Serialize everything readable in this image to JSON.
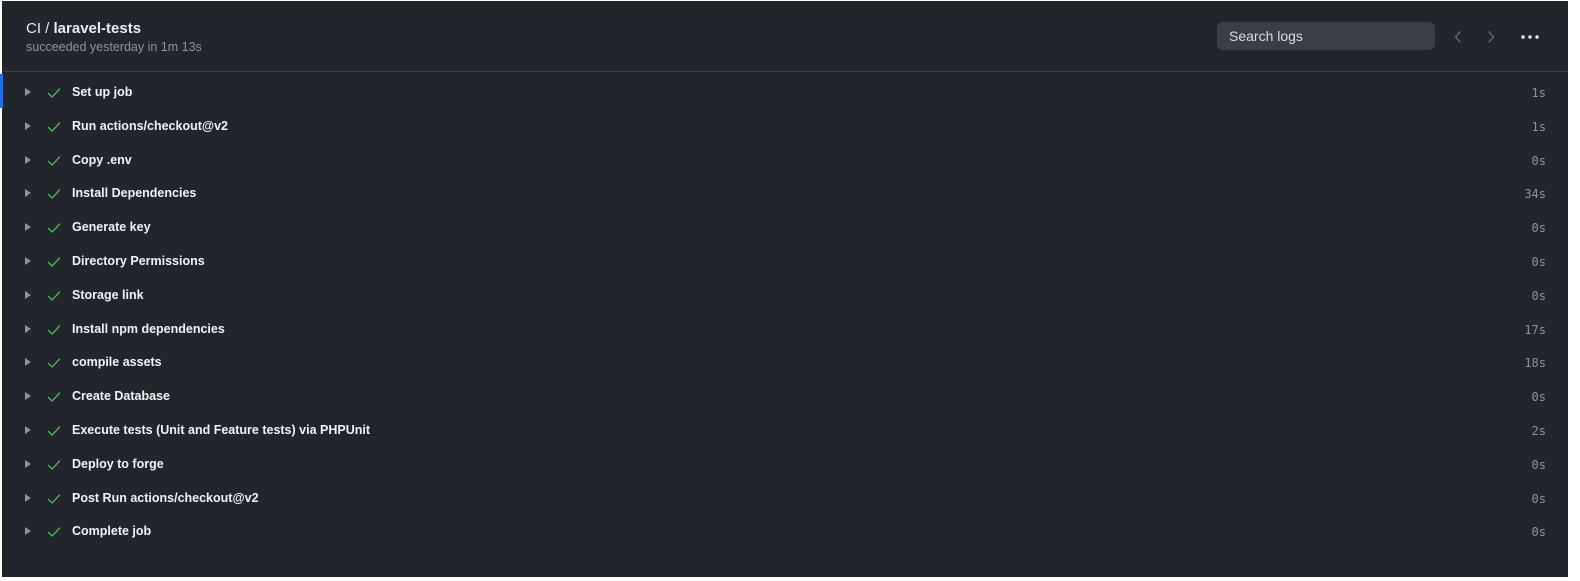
{
  "header": {
    "workflow": "CI",
    "separator": " / ",
    "job_name": "laravel-tests",
    "status_line": "succeeded yesterday in 1m 13s"
  },
  "search": {
    "placeholder": "Search logs"
  },
  "icons": {
    "prev": "chevron-left-icon",
    "next": "chevron-right-icon",
    "more": "kebab-horizontal-icon",
    "expand": "triangle-right-icon",
    "status": "check-icon"
  },
  "colors": {
    "background": "#22262c",
    "accent": "#1f6feb",
    "success": "#3fb950",
    "muted": "#8b949e"
  },
  "steps": [
    {
      "name": "Set up job",
      "duration": "1s"
    },
    {
      "name": "Run actions/checkout@v2",
      "duration": "1s"
    },
    {
      "name": "Copy .env",
      "duration": "0s"
    },
    {
      "name": "Install Dependencies",
      "duration": "34s"
    },
    {
      "name": "Generate key",
      "duration": "0s"
    },
    {
      "name": "Directory Permissions",
      "duration": "0s"
    },
    {
      "name": "Storage link",
      "duration": "0s"
    },
    {
      "name": "Install npm dependencies",
      "duration": "17s"
    },
    {
      "name": "compile assets",
      "duration": "18s"
    },
    {
      "name": "Create Database",
      "duration": "0s"
    },
    {
      "name": "Execute tests (Unit and Feature tests) via PHPUnit",
      "duration": "2s"
    },
    {
      "name": "Deploy to forge",
      "duration": "0s"
    },
    {
      "name": "Post Run actions/checkout@v2",
      "duration": "0s"
    },
    {
      "name": "Complete job",
      "duration": "0s"
    }
  ]
}
